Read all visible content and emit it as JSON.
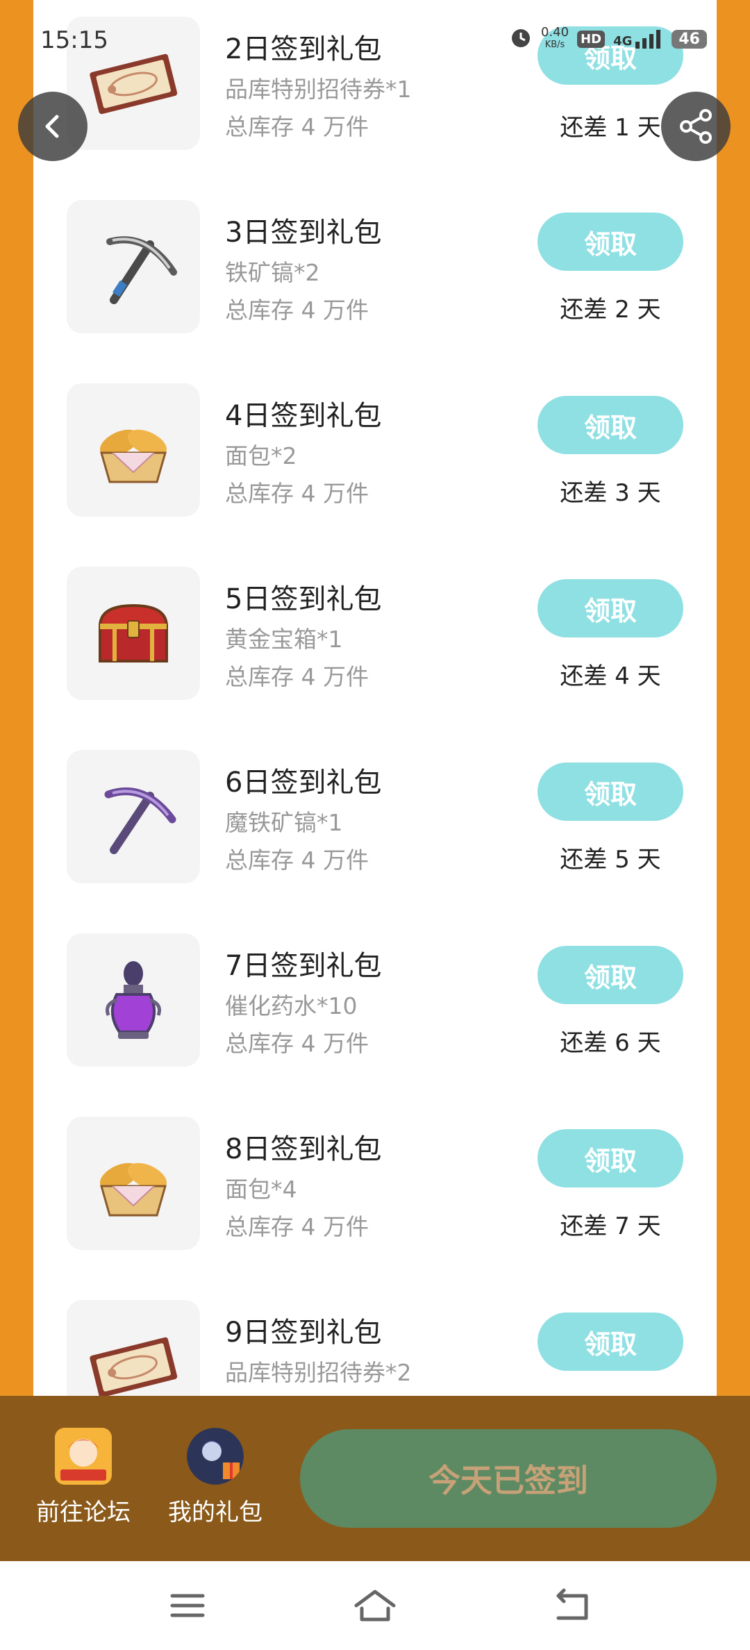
{
  "status_bar": {
    "time": "15:15",
    "net_speed": "0.40",
    "net_unit": "KB/s",
    "hd": "HD",
    "network": "4G",
    "battery": "46"
  },
  "gift_list": [
    {
      "title": "2日签到礼包",
      "item": "品库特别招待券*1",
      "stock": "总库存 4 万件",
      "button": "领取",
      "remaining": "还差 1 天",
      "icon": "ticket-icon"
    },
    {
      "title": "3日签到礼包",
      "item": "铁矿镐*2",
      "stock": "总库存 4 万件",
      "button": "领取",
      "remaining": "还差 2 天",
      "icon": "iron-pickaxe-icon"
    },
    {
      "title": "4日签到礼包",
      "item": "面包*2",
      "stock": "总库存 4 万件",
      "button": "领取",
      "remaining": "还差 3 天",
      "icon": "bread-basket-icon"
    },
    {
      "title": "5日签到礼包",
      "item": "黄金宝箱*1",
      "stock": "总库存 4 万件",
      "button": "领取",
      "remaining": "还差 4 天",
      "icon": "treasure-chest-icon"
    },
    {
      "title": "6日签到礼包",
      "item": "魔铁矿镐*1",
      "stock": "总库存 4 万件",
      "button": "领取",
      "remaining": "还差 5 天",
      "icon": "magic-pickaxe-icon"
    },
    {
      "title": "7日签到礼包",
      "item": "催化药水*10",
      "stock": "总库存 4 万件",
      "button": "领取",
      "remaining": "还差 6 天",
      "icon": "potion-icon"
    },
    {
      "title": "8日签到礼包",
      "item": "面包*4",
      "stock": "总库存 4 万件",
      "button": "领取",
      "remaining": "还差 7 天",
      "icon": "bread-basket-icon"
    },
    {
      "title": "9日签到礼包",
      "item": "品库特别招待券*2",
      "stock": "",
      "button": "领取",
      "remaining": "",
      "icon": "ticket-icon"
    }
  ],
  "bottom_bar": {
    "forum_label": "前往论坛",
    "gifts_label": "我的礼包",
    "signed_label": "今天已签到"
  },
  "colors": {
    "background": "#EC9221",
    "claim_button": "#8FE0E3",
    "bottom_bar": "#8B5A1A",
    "signed_button": "#5D8A62"
  }
}
